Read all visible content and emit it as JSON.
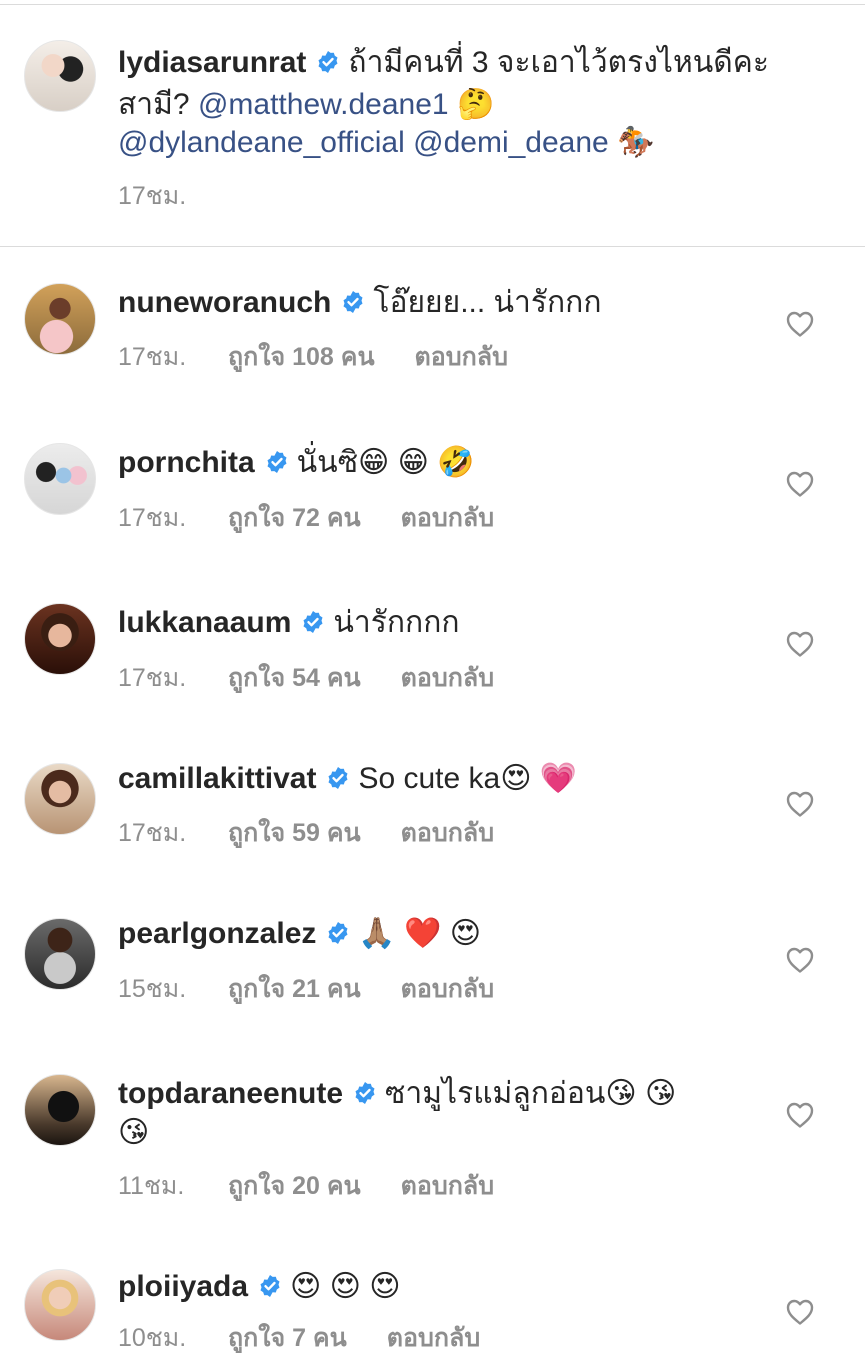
{
  "caption": {
    "username": "lydiasarunrat",
    "text_1": "ถ้ามีคนที่ 3 จะเอาไว้ตรงไหนดีคะ",
    "text_2": "สามี?",
    "mention_1": "@matthew.deane1",
    "emoji_1": "🤔",
    "mention_2": "@dylandeane_official",
    "mention_3": "@demi_deane",
    "emoji_2": "🏇",
    "time": "17ชม."
  },
  "comments": [
    {
      "username": "nuneworanuch",
      "text": "โอ๊ยยย... น่ารักกก",
      "time": "17ชม.",
      "likes": "ถูกใจ 108 คน",
      "reply": "ตอบกลับ"
    },
    {
      "username": "pornchita",
      "text": "นั่นซิ😁 😁 🤣",
      "time": "17ชม.",
      "likes": "ถูกใจ 72 คน",
      "reply": "ตอบกลับ"
    },
    {
      "username": "lukkanaaum",
      "text": "น่ารักกกก",
      "time": "17ชม.",
      "likes": "ถูกใจ 54 คน",
      "reply": "ตอบกลับ"
    },
    {
      "username": "camillakittivat",
      "text": "So cute ka😍 💗",
      "time": "17ชม.",
      "likes": "ถูกใจ 59 คน",
      "reply": "ตอบกลับ"
    },
    {
      "username": "pearlgonzalez",
      "text": "🙏🏽 ❤️ 😍",
      "time": "15ชม.",
      "likes": "ถูกใจ 21 คน",
      "reply": "ตอบกลับ"
    },
    {
      "username": "topdaraneenute",
      "text": "ซามูไรแม่ลูกอ่อน😘 😘",
      "text_2": "😘",
      "time": "11ชม.",
      "likes": "ถูกใจ 20 คน",
      "reply": "ตอบกลับ"
    },
    {
      "username": "ploiiyada",
      "text": "😍 😍 😍",
      "time": "10ชม.",
      "likes": "ถูกใจ 7 คน",
      "reply": "ตอบกลับ"
    }
  ],
  "icons": {
    "verified": "verified-badge-icon",
    "like": "heart-outline-icon"
  },
  "colors": {
    "verified": "#3897f0",
    "mention": "#385185",
    "meta": "#8e8e8e",
    "text": "#262626"
  }
}
